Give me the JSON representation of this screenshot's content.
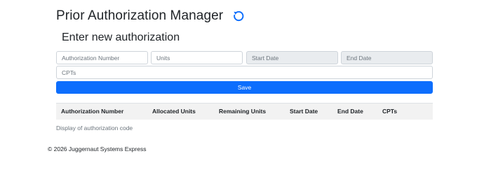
{
  "header": {
    "title": "Prior Authorization Manager",
    "refresh_icon": "refresh-icon",
    "accent_color": "#0d6efd"
  },
  "form": {
    "title": "Enter new authorization",
    "authorization_number": {
      "placeholder": "Authorization Number",
      "value": ""
    },
    "units": {
      "placeholder": "Units",
      "value": ""
    },
    "start_date": {
      "placeholder": "Start Date",
      "value": "",
      "disabled": true
    },
    "end_date": {
      "placeholder": "End Date",
      "value": "",
      "disabled": true
    },
    "cpts": {
      "placeholder": "CPTs",
      "value": ""
    },
    "save_label": "Save"
  },
  "table": {
    "columns": [
      "Authorization Number",
      "Allocated Units",
      "Remaining Units",
      "Start Date",
      "End Date",
      "CPTs"
    ],
    "rows": [],
    "caption": "Display of authorization code"
  },
  "footer": {
    "text": "© 2026 Juggernaut Systems Express"
  }
}
